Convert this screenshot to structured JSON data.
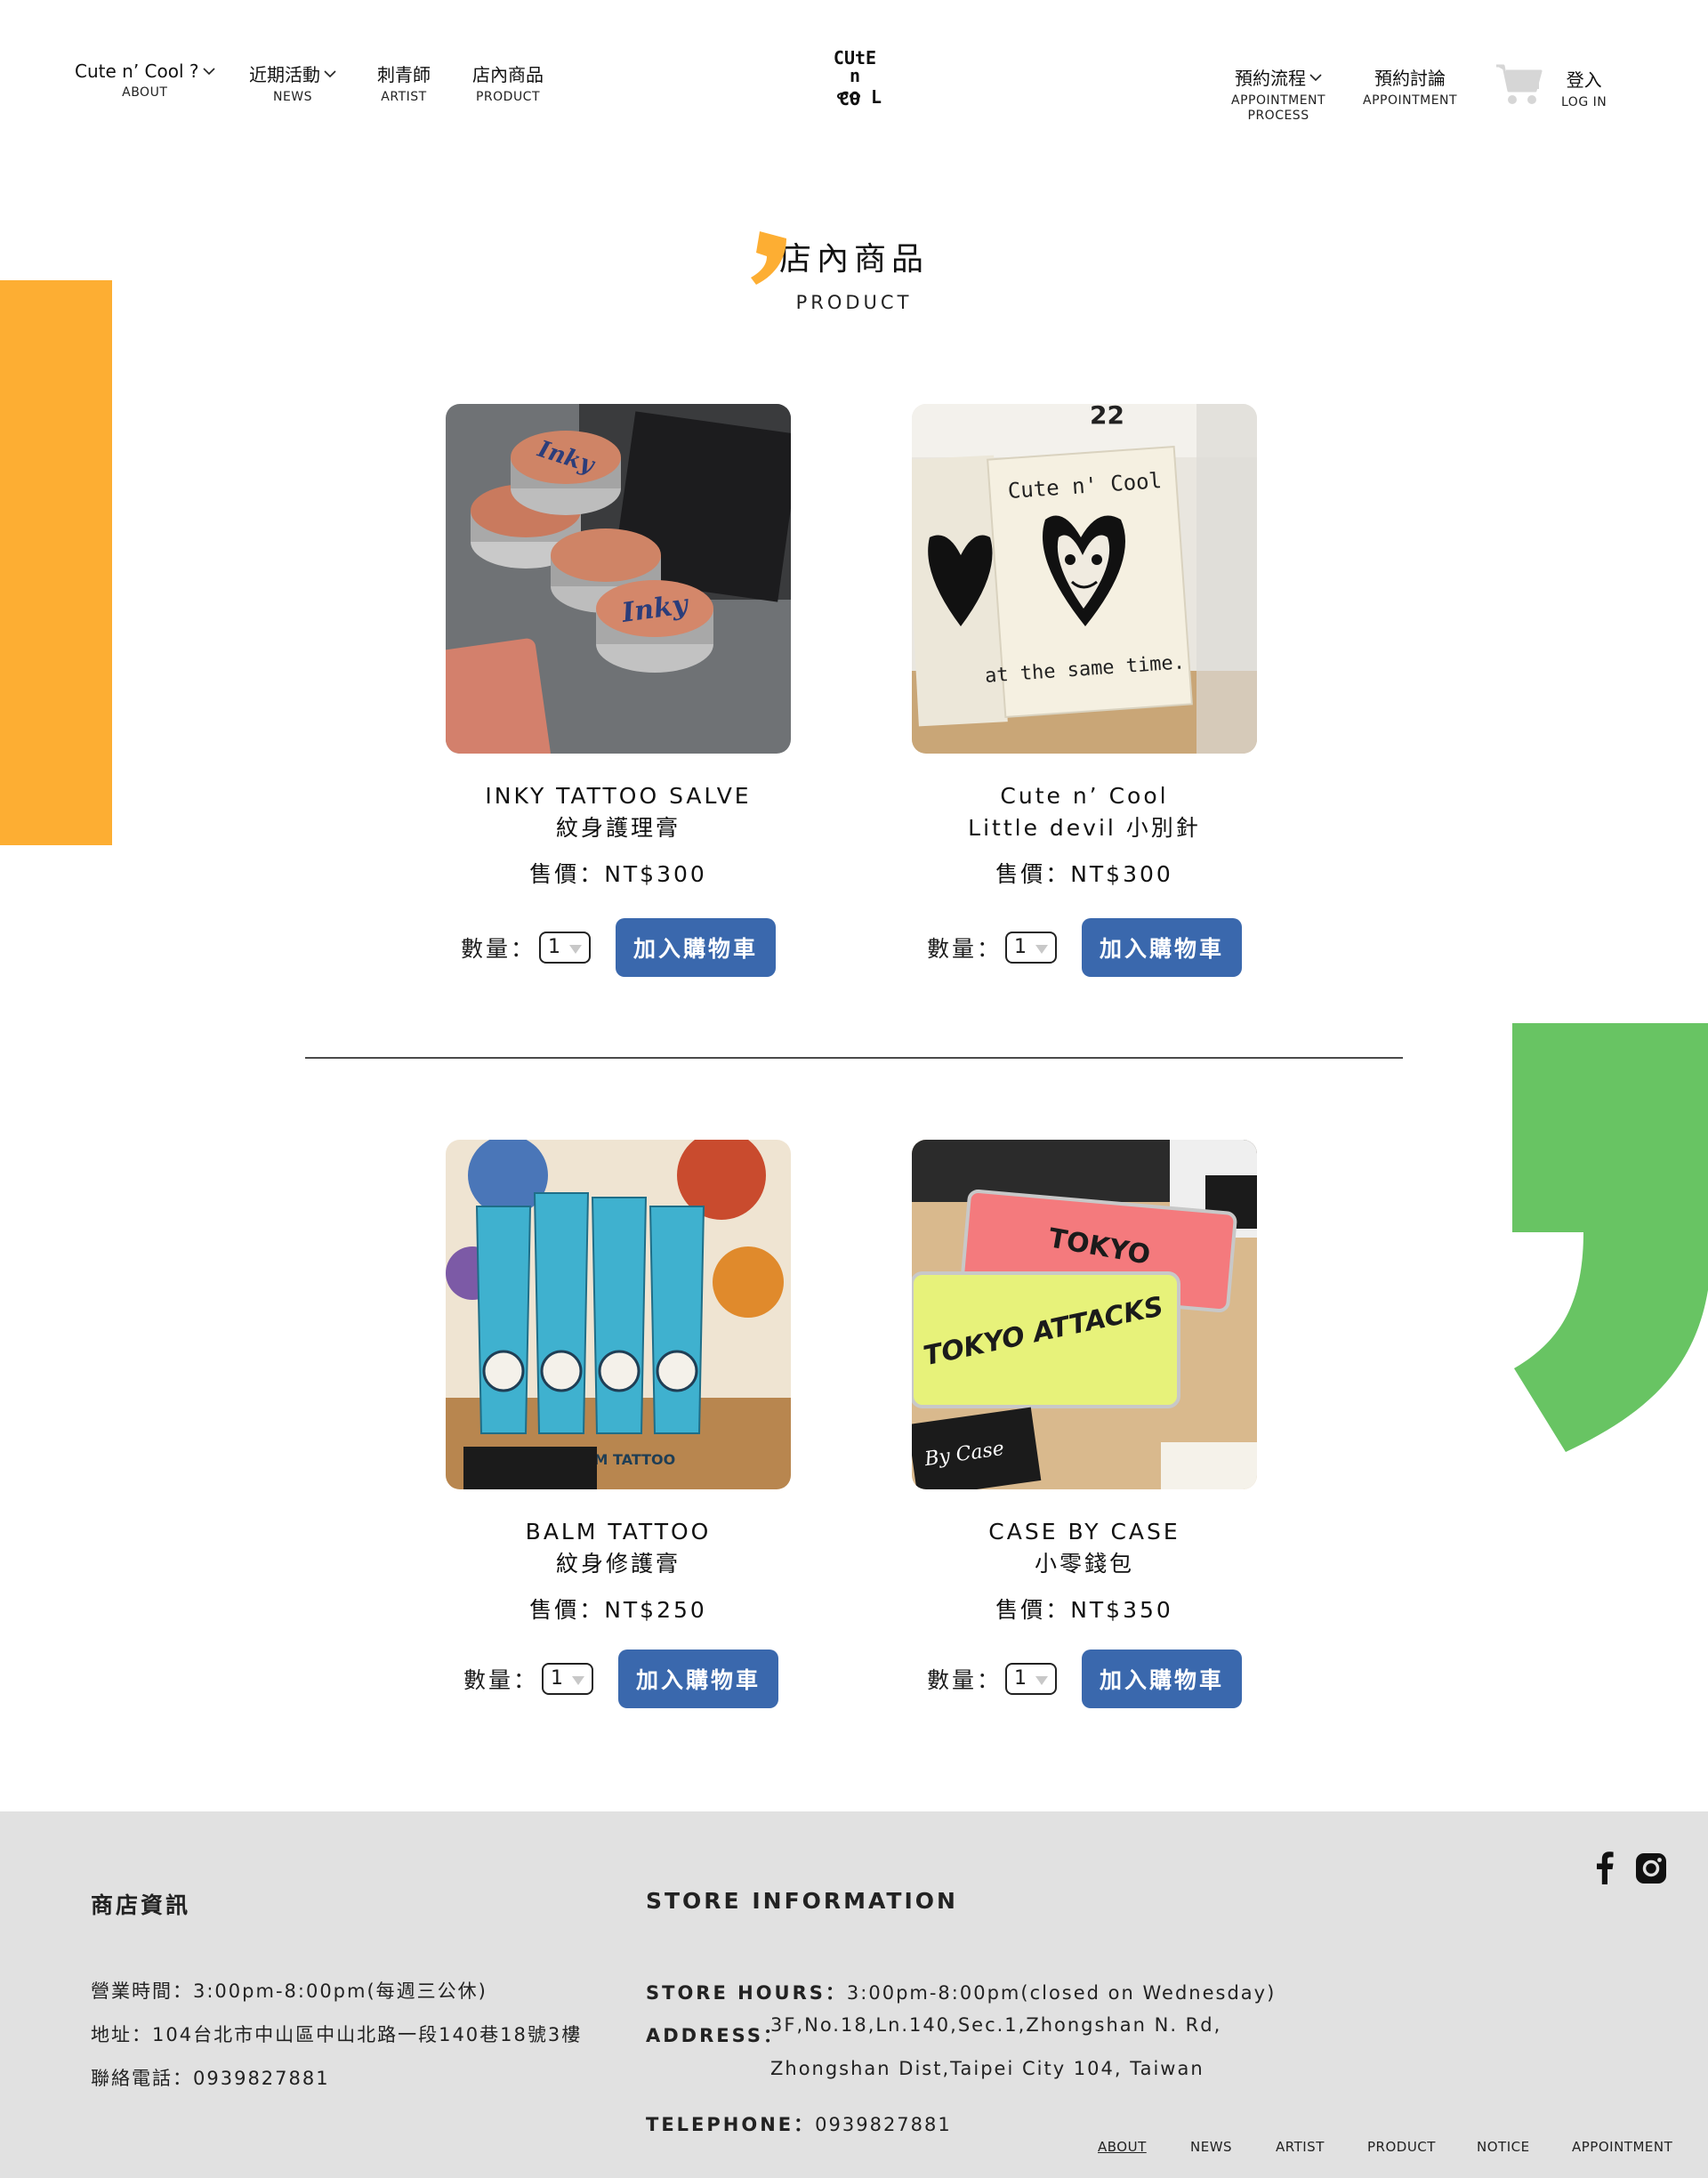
{
  "nav": {
    "left": [
      {
        "main": "Cute n’ Cool ?",
        "sub": "ABOUT"
      },
      {
        "main": "近期活動",
        "sub": "NEWS"
      },
      {
        "main": "刺青師",
        "sub": "ARTIST"
      },
      {
        "main": "店內商品",
        "sub": "PRODUCT"
      }
    ],
    "logo": {
      "line1": "CUtE",
      "line2": "n",
      "line3": "CO",
      "line4": "L"
    },
    "right": [
      {
        "main": "預約流程",
        "sub1": "APPOINTMENT",
        "sub2": "PROCESS"
      },
      {
        "main": "預約討論",
        "sub": "APPOINTMENT"
      }
    ],
    "login": {
      "main": "登入",
      "sub": "LOG IN"
    }
  },
  "page": {
    "title": "店內商品",
    "subtitle": "PRODUCT"
  },
  "products": [
    {
      "name": "INKY TATTOO SALVE",
      "name2": "紋身護理膏",
      "price": "售價：NT$300",
      "qty_label": "數量：",
      "qty": "1",
      "button": "加入購物車"
    },
    {
      "name": "Cute n’ Cool",
      "name2": "Little devil 小別針",
      "price": "售價：NT$300",
      "qty_label": "數量：",
      "qty": "1",
      "button": "加入購物車"
    },
    {
      "name": "BALM TATTOO",
      "name2": "紋身修護膏",
      "price": "售價：NT$250",
      "qty_label": "數量：",
      "qty": "1",
      "button": "加入購物車"
    },
    {
      "name": "CASE BY CASE",
      "name2": "小零錢包",
      "price": "售價：NT$350",
      "qty_label": "數量：",
      "qty": "1",
      "button": "加入購物車"
    }
  ],
  "image_text": {
    "inky": "Inky",
    "cute_card": "Cute n' Cool",
    "cute_card_bottom": "at the same time.",
    "balm": "BALM TATTOO",
    "tokyo": "TOKYO",
    "tokyo_attacks": "TOKYO ATTACKS",
    "by_case": "By Case"
  },
  "footer": {
    "zh_heading": "商店資訊",
    "zh_hours": "營業時間：3:00pm-8:00pm(每週三公休)",
    "zh_address": "地址：104台北市中山區中山北路一段140巷18號3樓",
    "zh_phone": "聯絡電話：0939827881",
    "en_heading": "STORE INFORMATION",
    "hours_label": "STORE HOURS：",
    "hours_value": "3:00pm-8:00pm(closed on Wednesday)",
    "address_label": "ADDRESS：",
    "address_line1": "3F,No.18,Ln.140,Sec.1,Zhongshan N. Rd,",
    "address_line2": "Zhongshan Dist,Taipei City 104, Taiwan",
    "phone_label": "TELEPHONE：",
    "phone_value": "0939827881",
    "links": [
      "ABOUT",
      "NEWS",
      "ARTIST",
      "PRODUCT",
      "NOTICE",
      "APPOINTMENT"
    ]
  },
  "colors": {
    "accent_orange": "#fdae33",
    "accent_green": "#68c463",
    "button_blue": "#3a68ad",
    "footer_bg": "#e1e1e1"
  },
  "icons": [
    "chevron-down-icon",
    "cart-icon",
    "facebook-icon",
    "instagram-icon"
  ]
}
